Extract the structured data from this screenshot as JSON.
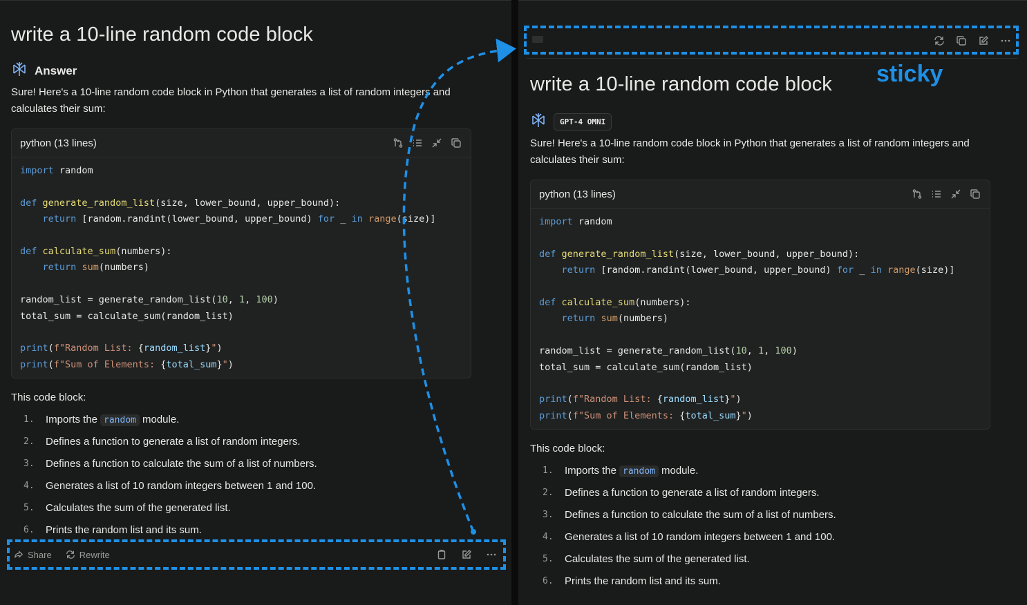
{
  "left": {
    "title": "write a 10-line random code block",
    "answer_label": "Answer",
    "intro": "Sure! Here's a 10-line random code block in Python that generates a list of random integers and calculates their sum:",
    "code_header": "python (13 lines)",
    "explain_heading": "This code block:",
    "footer": {
      "share": "Share",
      "rewrite": "Rewrite"
    }
  },
  "right": {
    "title": "write a 10-line random code block",
    "model_badge": "GPT-4 OMNI",
    "intro": "Sure! Here's a 10-line random code block in Python that generates a list of random integers and calculates their sum:",
    "code_header": "python (13 lines)",
    "explain_heading": "This code block:"
  },
  "list_items": [
    {
      "num": "1.",
      "pre": "Imports the",
      "code": "random",
      "post": "module."
    },
    {
      "num": "2.",
      "pre": "Defines a function to generate a list of random integers.",
      "code": "",
      "post": ""
    },
    {
      "num": "3.",
      "pre": "Defines a function to calculate the sum of a list of numbers.",
      "code": "",
      "post": ""
    },
    {
      "num": "4.",
      "pre": "Generates a list of 10 random integers between 1 and 100.",
      "code": "",
      "post": ""
    },
    {
      "num": "5.",
      "pre": "Calculates the sum of the generated list.",
      "code": "",
      "post": ""
    },
    {
      "num": "6.",
      "pre": "Prints the random list and its sum.",
      "code": "",
      "post": ""
    }
  ],
  "code_lines": [
    [
      {
        "t": "kw",
        "v": "import"
      },
      {
        "t": "",
        "v": " random"
      }
    ],
    [],
    [
      {
        "t": "kw",
        "v": "def"
      },
      {
        "t": "",
        "v": " "
      },
      {
        "t": "fn",
        "v": "generate_random_list"
      },
      {
        "t": "",
        "v": "(size, lower_bound, upper_bound):"
      }
    ],
    [
      {
        "t": "",
        "v": "    "
      },
      {
        "t": "kw",
        "v": "return"
      },
      {
        "t": "",
        "v": " [random.randint(lower_bound, upper_bound) "
      },
      {
        "t": "kw",
        "v": "for"
      },
      {
        "t": "",
        "v": " _ "
      },
      {
        "t": "kw",
        "v": "in"
      },
      {
        "t": "",
        "v": " "
      },
      {
        "t": "bi",
        "v": "range"
      },
      {
        "t": "",
        "v": "(size)]"
      }
    ],
    [],
    [
      {
        "t": "kw",
        "v": "def"
      },
      {
        "t": "",
        "v": " "
      },
      {
        "t": "fn",
        "v": "calculate_sum"
      },
      {
        "t": "",
        "v": "(numbers):"
      }
    ],
    [
      {
        "t": "",
        "v": "    "
      },
      {
        "t": "kw",
        "v": "return"
      },
      {
        "t": "",
        "v": " "
      },
      {
        "t": "bi",
        "v": "sum"
      },
      {
        "t": "",
        "v": "(numbers)"
      }
    ],
    [],
    [
      {
        "t": "",
        "v": "random_list = generate_random_list("
      },
      {
        "t": "num",
        "v": "10"
      },
      {
        "t": "",
        "v": ", "
      },
      {
        "t": "num",
        "v": "1"
      },
      {
        "t": "",
        "v": ", "
      },
      {
        "t": "num",
        "v": "100"
      },
      {
        "t": "",
        "v": ")"
      }
    ],
    [
      {
        "t": "",
        "v": "total_sum = calculate_sum(random_list)"
      }
    ],
    [],
    [
      {
        "t": "kw",
        "v": "print"
      },
      {
        "t": "",
        "v": "("
      },
      {
        "t": "str",
        "v": "f\"Random List: "
      },
      {
        "t": "",
        "v": "{"
      },
      {
        "t": "var",
        "v": "random_list"
      },
      {
        "t": "",
        "v": "}"
      },
      {
        "t": "str",
        "v": "\""
      },
      {
        "t": "",
        "v": ")"
      }
    ],
    [
      {
        "t": "kw",
        "v": "print"
      },
      {
        "t": "",
        "v": "("
      },
      {
        "t": "str",
        "v": "f\"Sum of Elements: "
      },
      {
        "t": "",
        "v": "{"
      },
      {
        "t": "var",
        "v": "total_sum"
      },
      {
        "t": "",
        "v": "}"
      },
      {
        "t": "str",
        "v": "\""
      },
      {
        "t": "",
        "v": ")"
      }
    ]
  ],
  "annotation": {
    "label": "sticky",
    "color": "#1e90e6"
  },
  "icons": {
    "code_header": [
      "pull-request-icon",
      "list-icon",
      "collapse-icon",
      "copy-icon"
    ],
    "footer": [
      "clipboard-icon",
      "edit-icon",
      "more-icon"
    ],
    "sticky": [
      "refresh-icon",
      "copy-icon",
      "edit-icon",
      "more-icon"
    ]
  }
}
